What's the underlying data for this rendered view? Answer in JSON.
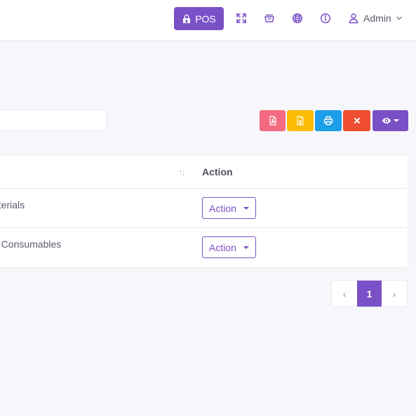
{
  "header": {
    "pos_label": "POS",
    "user_name": "Admin",
    "icons": [
      "store-icon",
      "fullscreen-icon",
      "basket-icon",
      "globe-icon",
      "info-icon",
      "user-icon",
      "chevron-down-icon"
    ]
  },
  "toolbar": {
    "search_value": "",
    "buttons": [
      "pdf-export",
      "excel-export",
      "print",
      "delete",
      "column-visibility"
    ],
    "colors": {
      "pdf": "#f46a80",
      "excel": "#fbbc06",
      "print": "#1d9ee8",
      "delete": "#ee4e2f",
      "view": "#7a50c7"
    }
  },
  "table": {
    "sort_indicator": "↑↓",
    "action_header": "Action",
    "rows": [
      {
        "name": "aterials",
        "action_label": "Action"
      },
      {
        "name": "g Consumables",
        "action_label": "Action"
      }
    ]
  },
  "pagination": {
    "prev": "‹",
    "current": "1",
    "next": "›"
  },
  "theme": {
    "accent": "#7a50c7"
  }
}
